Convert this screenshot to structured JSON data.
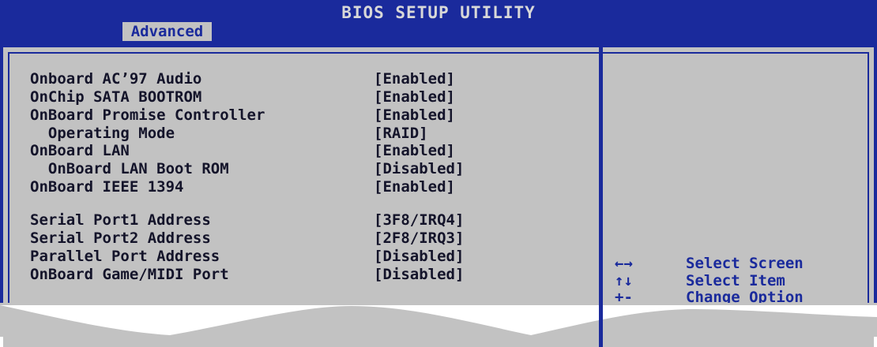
{
  "header": {
    "title": "BIOS SETUP UTILITY",
    "active_tab": "Advanced"
  },
  "settings": [
    {
      "label": "Onboard AC’97 Audio",
      "value": "[Enabled]"
    },
    {
      "label": "OnChip SATA BOOTROM",
      "value": "[Enabled]"
    },
    {
      "label": "OnBoard Promise Controller",
      "value": "[Enabled]"
    },
    {
      "label": "  Operating Mode",
      "value": "[RAID]"
    },
    {
      "label": "OnBoard LAN",
      "value": "[Enabled]"
    },
    {
      "label": "  OnBoard LAN Boot ROM",
      "value": "[Disabled]"
    },
    {
      "label": "OnBoard IEEE 1394",
      "value": "[Enabled]"
    },
    {
      "label": "Serial Port1 Address",
      "value": "[3F8/IRQ4]"
    },
    {
      "label": "Serial Port2 Address",
      "value": "[2F8/IRQ3]"
    },
    {
      "label": "Parallel Port Address",
      "value": "[Disabled]"
    },
    {
      "label": "OnBoard Game/MIDI Port",
      "value": "[Disabled]"
    }
  ],
  "help": [
    {
      "key": "←→",
      "desc": "Select Screen"
    },
    {
      "key": "↑↓",
      "desc": "Select Item"
    },
    {
      "key": "+-",
      "desc": "Change Option"
    }
  ],
  "colors": {
    "background_blue": "#1a2a9c",
    "panel_gray": "#c2c2c2",
    "text_dark": "#14142a",
    "title_light": "#d8d8d8"
  }
}
